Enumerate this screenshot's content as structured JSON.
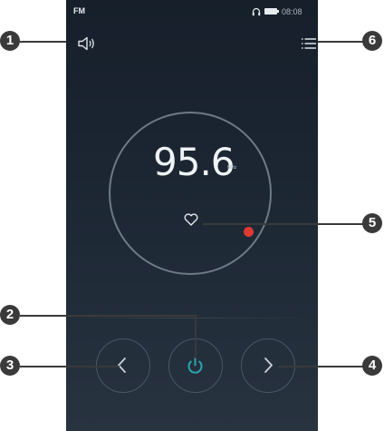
{
  "status_bar": {
    "app_label": "FM",
    "time": "08:08",
    "icons": [
      "headphone-icon",
      "battery-icon"
    ]
  },
  "player": {
    "frequency": "95.6",
    "unit": "MHz"
  },
  "controls": {
    "speaker_icon": "speaker-icon",
    "menu_icon": "list-menu-icon",
    "favorite_icon": "heart-icon",
    "prev_icon": "chevron-left-icon",
    "power_icon": "power-icon",
    "next_icon": "chevron-right-icon"
  },
  "colors": {
    "background": "#1b2530",
    "power_accent": "#2aa6b2",
    "tuner_dot": "#de3a31",
    "dial_ring": "#6e7b87"
  },
  "callouts": [
    "1",
    "2",
    "3",
    "4",
    "5",
    "6"
  ]
}
